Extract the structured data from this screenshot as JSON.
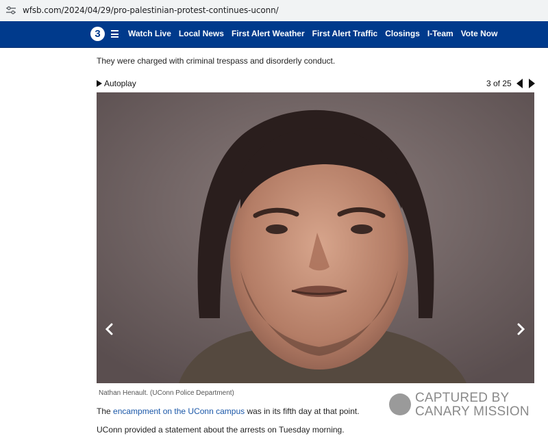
{
  "browser": {
    "url": "wfsb.com/2024/04/29/pro-palestinian-protest-continues-uconn/",
    "tune_icon": "site-settings-icon"
  },
  "nav": {
    "logo_text": "3",
    "menu_icon": "hamburger-icon",
    "items": [
      "Watch Live",
      "Local News",
      "First Alert Weather",
      "First Alert Traffic",
      "Closings",
      "I-Team",
      "Vote Now"
    ]
  },
  "article": {
    "paragraph1": "They were charged with criminal trespass and disorderly conduct.",
    "gallery": {
      "autoplay_label": "Autoplay",
      "counter": "3 of 25",
      "caption": "Nathan Henault.  (UConn Police Department)"
    },
    "paragraph2_pre": "The ",
    "paragraph2_link": "encampment on the UConn campus",
    "paragraph2_post": " was in its fifth day at that point.",
    "paragraph3": "UConn provided a statement about the arrests on Tuesday morning."
  },
  "watermark": {
    "line1": "CAPTURED BY",
    "line2": "CANARY MISSION"
  },
  "colors": {
    "nav_bg": "#003a8c",
    "link": "#1a57a8",
    "urlbar_bg": "#f1f3f4"
  }
}
